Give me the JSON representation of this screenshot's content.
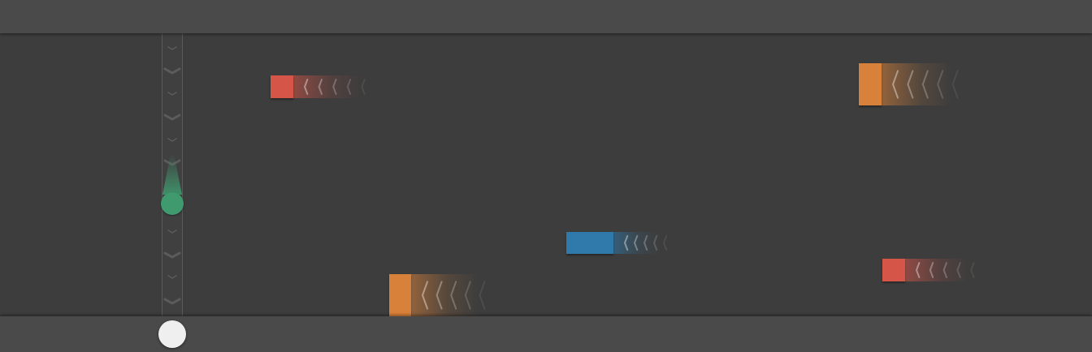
{
  "colors": {
    "background": "#3d3d3d",
    "bar": "#4a4a4a",
    "player": "#3f9a6e",
    "knob": "#efefef",
    "red": "#d55548",
    "orange": "#d8813a",
    "blue": "#2f79ab",
    "lane_chevron": "#5c5c5c"
  },
  "lane": {
    "direction": "down",
    "chevron_icon": "chevron-down-icon"
  },
  "player": {
    "icon": "player-ball",
    "color": "#3f9a6e"
  },
  "control": {
    "icon": "slider-knob"
  },
  "obstacles": [
    {
      "name": "obstacle-red-1",
      "color": "#d55548"
    },
    {
      "name": "obstacle-orange-1",
      "color": "#d8813a"
    },
    {
      "name": "obstacle-blue-1",
      "color": "#2f79ab"
    },
    {
      "name": "obstacle-red-2",
      "color": "#d55548"
    },
    {
      "name": "obstacle-orange-2",
      "color": "#d8813a"
    }
  ]
}
